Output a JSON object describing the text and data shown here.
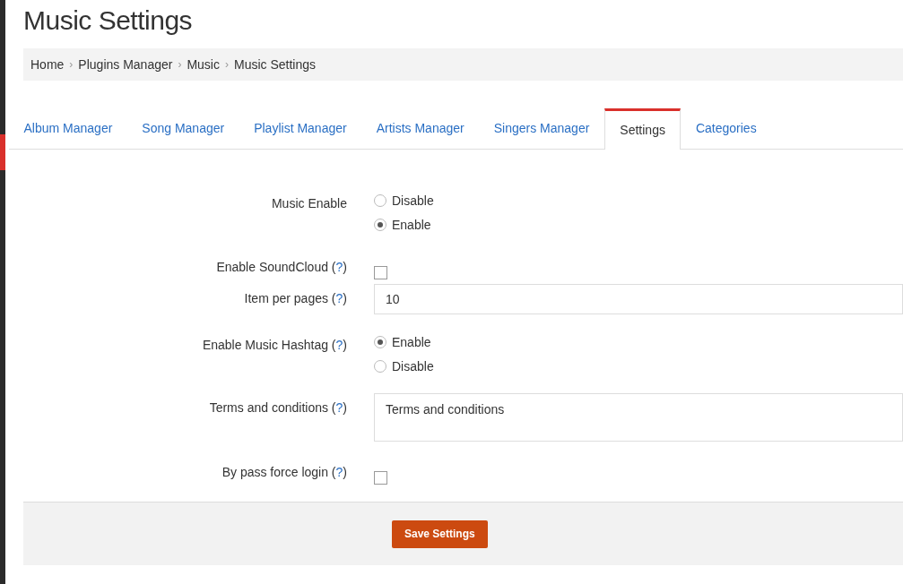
{
  "page_title": "Music Settings",
  "breadcrumb": [
    "Home",
    "Plugins Manager",
    "Music",
    "Music Settings"
  ],
  "breadcrumb_separator": "›",
  "tabs": [
    {
      "label": "Album Manager",
      "selected": false
    },
    {
      "label": "Song Manager",
      "selected": false
    },
    {
      "label": "Playlist Manager",
      "selected": false
    },
    {
      "label": "Artists Manager",
      "selected": false
    },
    {
      "label": "Singers Manager",
      "selected": false
    },
    {
      "label": "Settings",
      "selected": true
    },
    {
      "label": "Categories",
      "selected": false
    }
  ],
  "fields": [
    {
      "kind": "radio",
      "label": "Music Enable",
      "options": [
        {
          "label": "Disable",
          "selected": false
        },
        {
          "label": "Enable",
          "selected": true
        }
      ]
    },
    {
      "kind": "checkbox",
      "label": "Enable SoundCloud",
      "help": "(?)",
      "checked": false
    },
    {
      "kind": "text",
      "label": "Item per pages",
      "help": "(?)",
      "value": "10"
    },
    {
      "kind": "radio",
      "label": "Enable Music Hashtag",
      "help": "(?)",
      "options": [
        {
          "label": "Enable",
          "selected": true
        },
        {
          "label": "Disable",
          "selected": false
        }
      ]
    },
    {
      "kind": "textarea",
      "label": "Terms and conditions",
      "help": "(?)",
      "value": "Terms and conditions"
    },
    {
      "kind": "checkbox",
      "label": "By pass force login",
      "help": "(?)",
      "checked": false
    }
  ],
  "save_button": "Save Settings"
}
